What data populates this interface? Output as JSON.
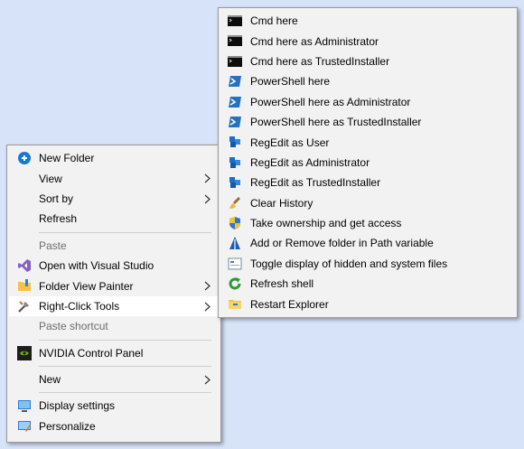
{
  "main_menu": {
    "items": [
      {
        "label": "New Folder",
        "icon": "new-folder-icon",
        "submenu": false,
        "disabled": false
      },
      {
        "label": "View",
        "icon": "",
        "submenu": true,
        "disabled": false
      },
      {
        "label": "Sort by",
        "icon": "",
        "submenu": true,
        "disabled": false
      },
      {
        "label": "Refresh",
        "icon": "",
        "submenu": false,
        "disabled": false
      },
      {
        "label": "Paste",
        "icon": "",
        "submenu": false,
        "disabled": true
      },
      {
        "label": "Open with Visual Studio",
        "icon": "visual-studio-icon",
        "submenu": false,
        "disabled": false
      },
      {
        "label": "Folder View Painter",
        "icon": "folder-painter-icon",
        "submenu": true,
        "disabled": false
      },
      {
        "label": "Right-Click Tools",
        "icon": "tools-icon",
        "submenu": true,
        "disabled": false,
        "active": true
      },
      {
        "label": "Paste shortcut",
        "icon": "",
        "submenu": false,
        "disabled": true
      },
      {
        "label": "NVIDIA Control Panel",
        "icon": "nvidia-icon",
        "submenu": false,
        "disabled": false
      },
      {
        "label": "New",
        "icon": "",
        "submenu": true,
        "disabled": false
      },
      {
        "label": "Display settings",
        "icon": "display-icon",
        "submenu": false,
        "disabled": false
      },
      {
        "label": "Personalize",
        "icon": "personalize-icon",
        "submenu": false,
        "disabled": false
      }
    ]
  },
  "sub_menu": {
    "items": [
      {
        "label": "Cmd here",
        "icon": "cmd-icon"
      },
      {
        "label": "Cmd here as Administrator",
        "icon": "cmd-icon"
      },
      {
        "label": "Cmd here as TrustedInstaller",
        "icon": "cmd-icon"
      },
      {
        "label": "PowerShell here",
        "icon": "powershell-icon"
      },
      {
        "label": "PowerShell here as Administrator",
        "icon": "powershell-icon"
      },
      {
        "label": "PowerShell here as TrustedInstaller",
        "icon": "powershell-icon"
      },
      {
        "label": "RegEdit as User",
        "icon": "regedit-icon"
      },
      {
        "label": "RegEdit as Administrator",
        "icon": "regedit-icon"
      },
      {
        "label": "RegEdit as TrustedInstaller",
        "icon": "regedit-icon"
      },
      {
        "label": "Clear History",
        "icon": "clear-history-icon"
      },
      {
        "label": "Take ownership and get access",
        "icon": "shield-icon"
      },
      {
        "label": "Add or Remove folder in Path variable",
        "icon": "path-variable-icon"
      },
      {
        "label": "Toggle display of hidden and system files",
        "icon": "toggle-hidden-icon"
      },
      {
        "label": "Refresh shell",
        "icon": "refresh-shell-icon"
      },
      {
        "label": "Restart Explorer",
        "icon": "restart-explorer-icon"
      }
    ]
  },
  "colors": {
    "background": "#d6e3f8",
    "menu_bg": "#f2f2f2",
    "disabled_text": "#6d6d6d"
  }
}
